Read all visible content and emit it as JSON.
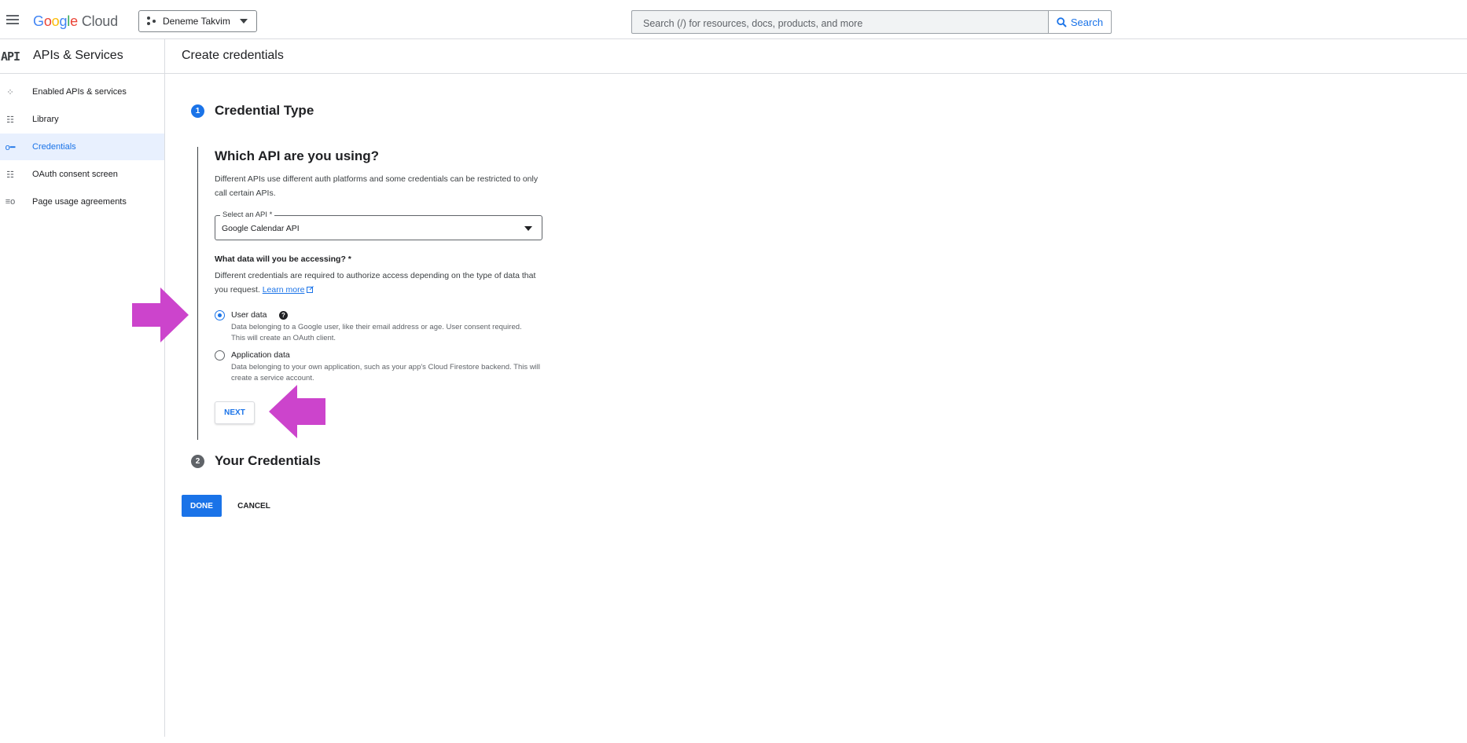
{
  "topbar": {
    "logo": {
      "letters": [
        "G",
        "o",
        "o",
        "g",
        "l",
        "e"
      ],
      "product": "Cloud"
    },
    "project": "Deneme Takvim",
    "search_placeholder": "Search (/) for resources, docs, products, and more",
    "search_button": "Search"
  },
  "sidebar": {
    "api_mark": "API",
    "title": "APIs & Services",
    "items": [
      {
        "label": "Enabled APIs & services",
        "icon": "enabled-apis-icon",
        "glyph": "⁘",
        "active": false
      },
      {
        "label": "Library",
        "icon": "library-icon",
        "glyph": "☷",
        "active": false
      },
      {
        "label": "Credentials",
        "icon": "key-icon",
        "glyph": "o━",
        "active": true
      },
      {
        "label": "OAuth consent screen",
        "icon": "consent-icon",
        "glyph": "☷",
        "active": false
      },
      {
        "label": "Page usage agreements",
        "icon": "agreements-icon",
        "glyph": "≡o",
        "active": false
      }
    ]
  },
  "page": {
    "title": "Create credentials",
    "step1": {
      "number": "1",
      "title": "Credential Type"
    },
    "question": "Which API are you using?",
    "question_desc": "Different APIs use different auth platforms and some credentials can be restricted to only call certain APIs.",
    "select": {
      "label": "Select an API *",
      "value": "Google Calendar API"
    },
    "data_question": "What data will you be accessing? *",
    "data_desc": "Different credentials are required to authorize access depending on the type of data that you request.",
    "learn_more": "Learn more",
    "options": [
      {
        "label": "User data",
        "desc": "Data belonging to a Google user, like their email address or age. User consent required. This will create an OAuth client.",
        "selected": true,
        "help": "?"
      },
      {
        "label": "Application data",
        "desc": "Data belonging to your own application, such as your app's Cloud Firestore backend. This will create a service account.",
        "selected": false
      }
    ],
    "next_button": "NEXT",
    "step2": {
      "number": "2",
      "title": "Your Credentials"
    },
    "done_button": "DONE",
    "cancel_button": "CANCEL"
  },
  "colors": {
    "accent": "#1a73e8",
    "annotation_arrow": "#cc44cc",
    "step2_badge": "#5f6368"
  }
}
